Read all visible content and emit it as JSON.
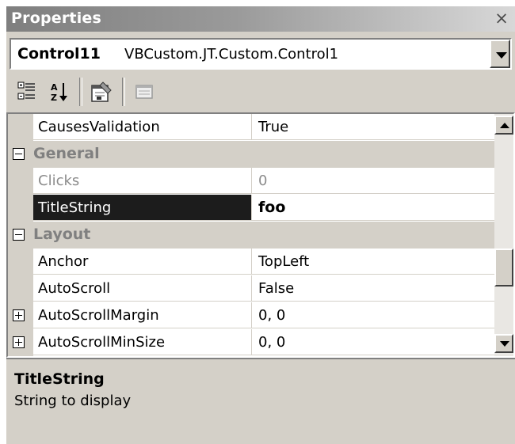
{
  "window": {
    "title": "Properties",
    "close_glyph": "×"
  },
  "object_selector": {
    "name": "Control11",
    "type": "VBCustom.JT.Custom.Control1"
  },
  "toolbar": {
    "buttons": [
      "categorized-icon",
      "alphabetical-icon",
      "properties-icon",
      "property-pages-icon"
    ]
  },
  "grid": {
    "rows": [
      {
        "kind": "property",
        "name": "CausesValidation",
        "value": "True"
      },
      {
        "kind": "category",
        "name": "General",
        "expanded": true
      },
      {
        "kind": "property",
        "name": "Clicks",
        "value": "0",
        "readonly": true
      },
      {
        "kind": "property",
        "name": "TitleString",
        "value": "foo",
        "selected": true
      },
      {
        "kind": "category",
        "name": "Layout",
        "expanded": true
      },
      {
        "kind": "property",
        "name": "Anchor",
        "value": "TopLeft"
      },
      {
        "kind": "property",
        "name": "AutoScroll",
        "value": "False"
      },
      {
        "kind": "property",
        "name": "AutoScrollMargin",
        "value": "0, 0",
        "expandable": true
      },
      {
        "kind": "property",
        "name": "AutoScrollMinSize",
        "value": "0, 0",
        "expandable": true
      }
    ]
  },
  "description": {
    "title": "TitleString",
    "text": "String to display"
  },
  "colors": {
    "panel": "#d4d0c8",
    "selected_row": "#1c1c1c",
    "category_text": "#808080"
  }
}
